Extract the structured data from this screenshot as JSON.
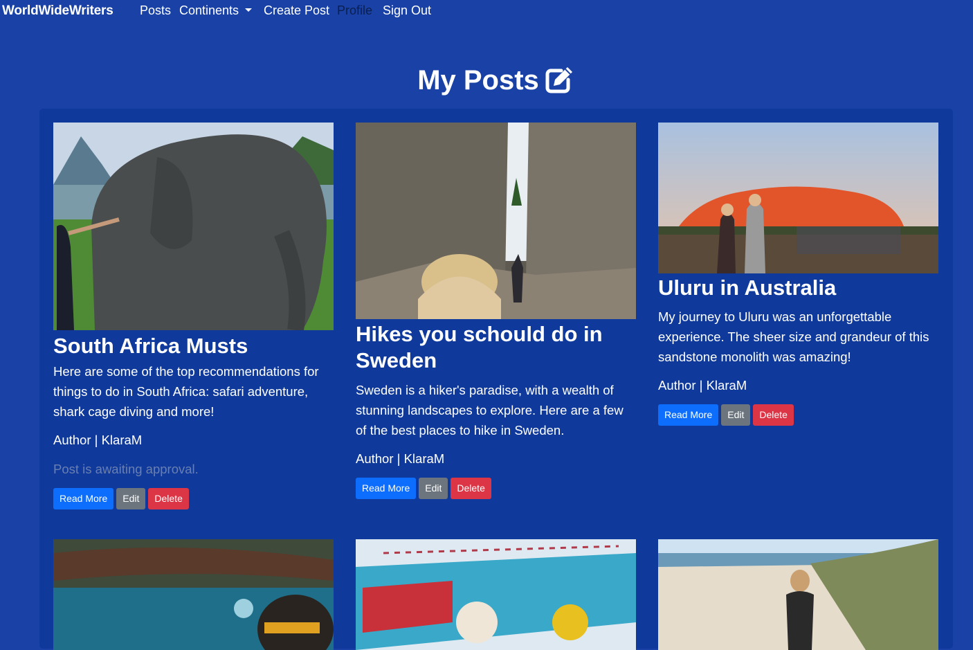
{
  "navbar": {
    "brand": "WorldWideWriters",
    "links": {
      "posts": "Posts",
      "continents": "Continents",
      "create_post": "Create Post",
      "profile": "Profile",
      "sign_out": "Sign Out"
    }
  },
  "page": {
    "title": "My Posts",
    "title_icon": "edit-square-icon"
  },
  "colors": {
    "background": "#1a42a6",
    "panel": "#0f3a9c",
    "primary": "#0d6efd",
    "secondary": "#6c757d",
    "danger": "#dc3545",
    "muted_text": "#6b7fae"
  },
  "buttons": {
    "read_more": "Read More",
    "edit": "Edit",
    "delete": "Delete"
  },
  "posts": [
    {
      "title": "South Africa Musts",
      "excerpt": "Here are some of the top recommendations for things to do in South Africa: safari adventure, shark cage diving and more!",
      "author": "Author | KlaraM",
      "status": "Post is awaiting approval.",
      "image": "elephant-photo"
    },
    {
      "title": "Hikes you schould do in Sweden",
      "excerpt": "Sweden is a hiker's paradise, with a wealth of stunning landscapes to explore. Here are a few of the best places to hike in Sweden.",
      "author": "Author | KlaraM",
      "image": "canyon-hike-photo"
    },
    {
      "title": "Uluru in Australia",
      "excerpt": "My journey to Uluru was an unforgettable experience. The sheer size and grandeur of this sandstone monolith was amazing!",
      "author": "Author | KlaraM",
      "image": "uluru-photo"
    },
    {
      "image": "underwater-diving-photo"
    },
    {
      "image": "krusty-sign-photo"
    },
    {
      "image": "beach-photo"
    }
  ]
}
